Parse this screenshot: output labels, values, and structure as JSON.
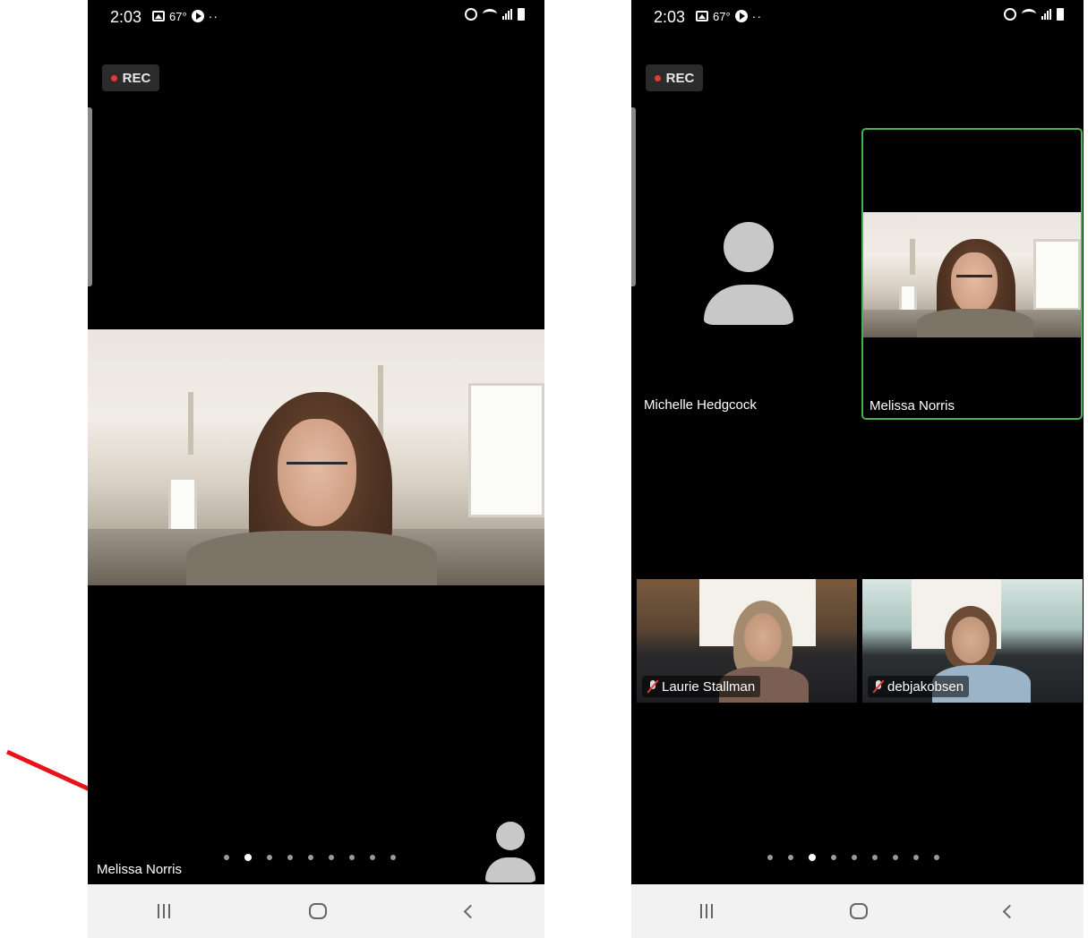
{
  "status_bar": {
    "time": "2:03",
    "temperature": "67°",
    "more_indicator": "··"
  },
  "recording": {
    "label": "REC",
    "color": "#e53935"
  },
  "left_screen": {
    "speaker_name": "Melissa Norris",
    "page_dots": {
      "count": 9,
      "active_index": 1
    }
  },
  "right_screen": {
    "tiles": [
      {
        "name": "Michelle Hedgcock",
        "video": false,
        "muted": false,
        "active_speaker": false
      },
      {
        "name": "Melissa Norris",
        "video": true,
        "muted": false,
        "active_speaker": true
      },
      {
        "name": "Laurie Stallman",
        "video": true,
        "muted": true,
        "active_speaker": false
      },
      {
        "name": "debjakobsen",
        "video": true,
        "muted": true,
        "active_speaker": false
      }
    ],
    "page_dots": {
      "count": 9,
      "active_index": 2
    }
  },
  "nav_bar": {
    "recents_icon": "recents-icon",
    "home_icon": "home-icon",
    "back_icon": "back-icon"
  },
  "colors": {
    "active_speaker_border": "#4caf50",
    "annotation_arrow": "#e8121a"
  }
}
